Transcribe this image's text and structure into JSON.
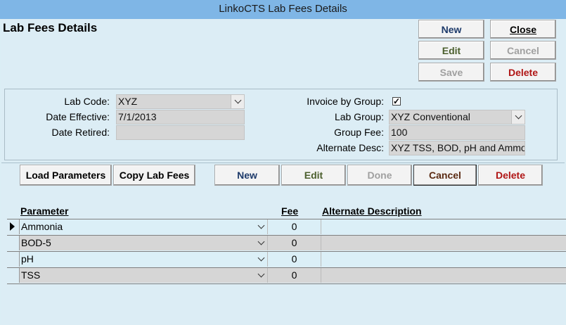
{
  "window": {
    "title": "LinkoCTS Lab Fees Details"
  },
  "page": {
    "heading": "Lab Fees Details"
  },
  "toolbar": {
    "new": "New",
    "close": "Close",
    "edit": "Edit",
    "cancel": "Cancel",
    "save": "Save",
    "delete": "Delete"
  },
  "form": {
    "lab_code_label": "Lab Code:",
    "lab_code_value": "XYZ",
    "date_effective_label": "Date Effective:",
    "date_effective_value": "7/1/2013",
    "date_retired_label": "Date Retired:",
    "date_retired_value": "",
    "invoice_by_group_label": "Invoice by Group:",
    "invoice_by_group_checked": "✓",
    "lab_group_label": "Lab Group:",
    "lab_group_value": "XYZ Conventional",
    "group_fee_label": "Group Fee:",
    "group_fee_value": "100",
    "alternate_desc_label": "Alternate Desc:",
    "alternate_desc_value": "XYZ TSS, BOD, pH and Ammo"
  },
  "subtoolbar": {
    "load_parameters": "Load Parameters",
    "copy_lab_fees": "Copy Lab Fees",
    "new": "New",
    "edit": "Edit",
    "done": "Done",
    "cancel": "Cancel",
    "delete": "Delete"
  },
  "grid": {
    "headers": {
      "parameter": "Parameter",
      "fee": "Fee",
      "alternate_description": "Alternate Description"
    },
    "rows": [
      {
        "parameter": "Ammonia",
        "fee": "0",
        "alt": ""
      },
      {
        "parameter": "BOD-5",
        "fee": "0",
        "alt": ""
      },
      {
        "parameter": "pH",
        "fee": "0",
        "alt": ""
      },
      {
        "parameter": "TSS",
        "fee": "0",
        "alt": ""
      }
    ]
  },
  "colors": {
    "titlebar": "#7fb6e6",
    "background": "#dcedf5",
    "field": "#d6d6d6",
    "accent_red": "#b01515",
    "accent_blue": "#1d3a6a",
    "accent_green": "#4a5e2c"
  }
}
